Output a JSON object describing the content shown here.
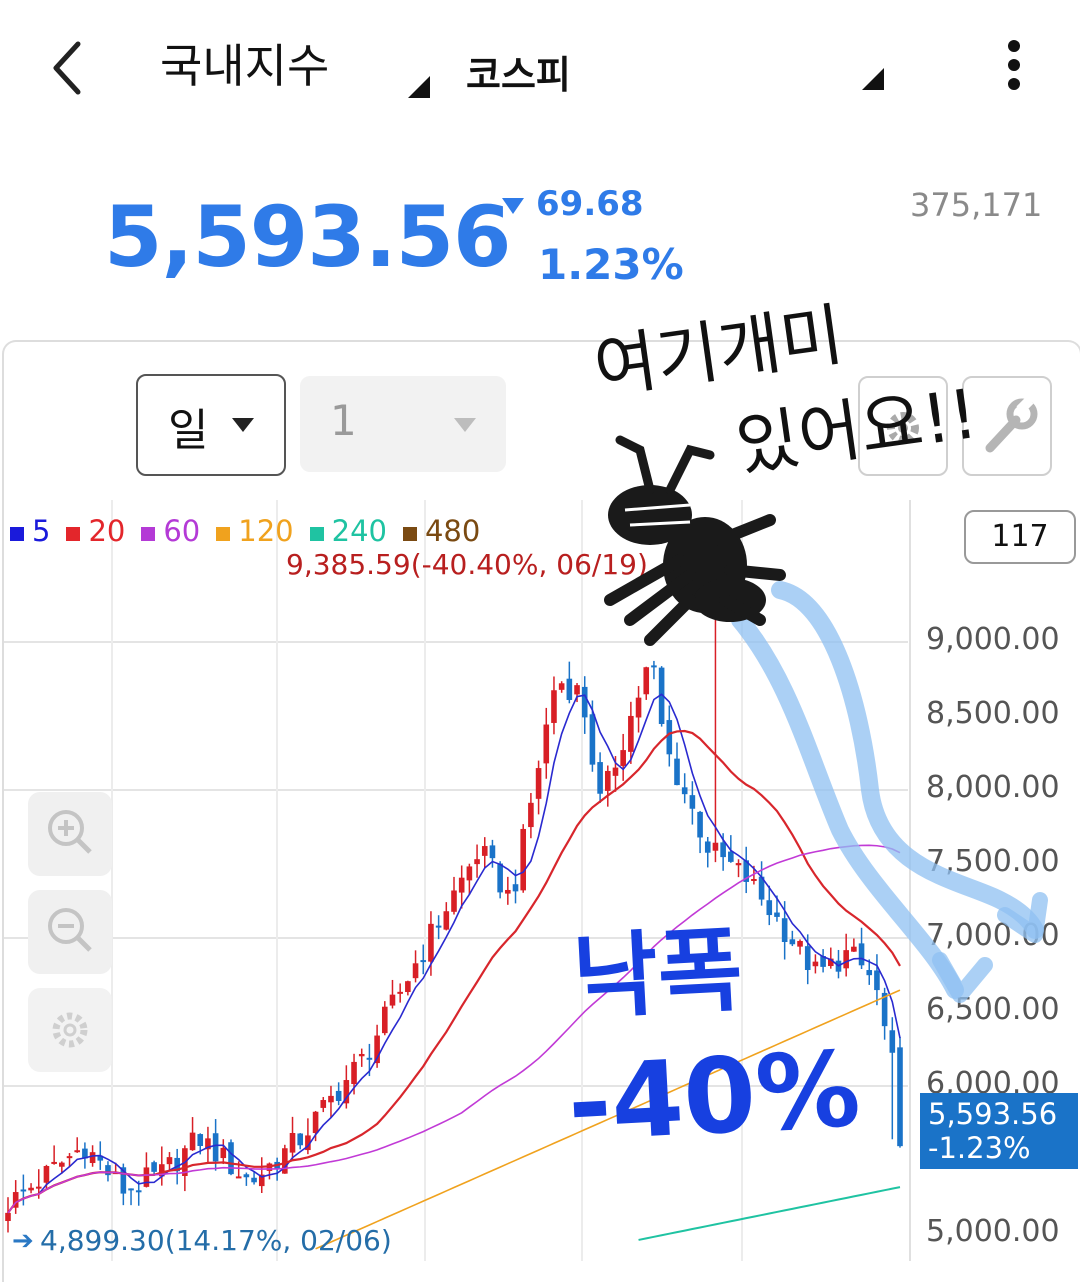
{
  "header": {
    "title": "국내지수",
    "market": "코스피",
    "back_icon": "chevron-left-icon",
    "more_icon": "more-vertical-icon"
  },
  "quote": {
    "price": "5,593.56",
    "change_value": "69.68",
    "change_pct": "1.23%",
    "volume": "375,171",
    "direction": "down",
    "color": "#2f7be8"
  },
  "controls": {
    "period": "일",
    "count": "1",
    "settings_icon": "gear-icon",
    "tools_icon": "wrench-icon"
  },
  "legend": [
    {
      "label": "5",
      "color": "#1a1adb"
    },
    {
      "label": "20",
      "color": "#e3262b"
    },
    {
      "label": "60",
      "color": "#b43ad6"
    },
    {
      "label": "120",
      "color": "#f0a21e"
    },
    {
      "label": "240",
      "color": "#1fc3a2"
    },
    {
      "label": "480",
      "color": "#7a4a12"
    }
  ],
  "visible_count": "117",
  "current_badge": {
    "price": "5,593.56",
    "pct": "-1.23%"
  },
  "handwriting": {
    "line1": "여기개미",
    "line2": "있어요!!",
    "drop_word": "낙폭",
    "drop_pct": "-40%"
  },
  "chart_data": {
    "type": "candlestick",
    "y_ticks": [
      "9,000.00",
      "8,500.00",
      "8,000.00",
      "7,500.00",
      "7,000.00",
      "6,500.00",
      "6,000.00",
      "5,000.00"
    ],
    "ylim": [
      4930,
      9500
    ],
    "high_annotation": "9,385.59(-40.40%, 06/19)",
    "low_annotation": "4,899.30(14.17%, 02/06)",
    "last": 5593.56,
    "ma_periods": [
      5,
      20,
      60,
      120,
      240,
      480
    ],
    "up_color": "#d81f26",
    "down_color": "#1a73c8",
    "grid": "on"
  },
  "side_controls": [
    "zoom-in-icon",
    "zoom-out-icon",
    "gear-icon"
  ]
}
